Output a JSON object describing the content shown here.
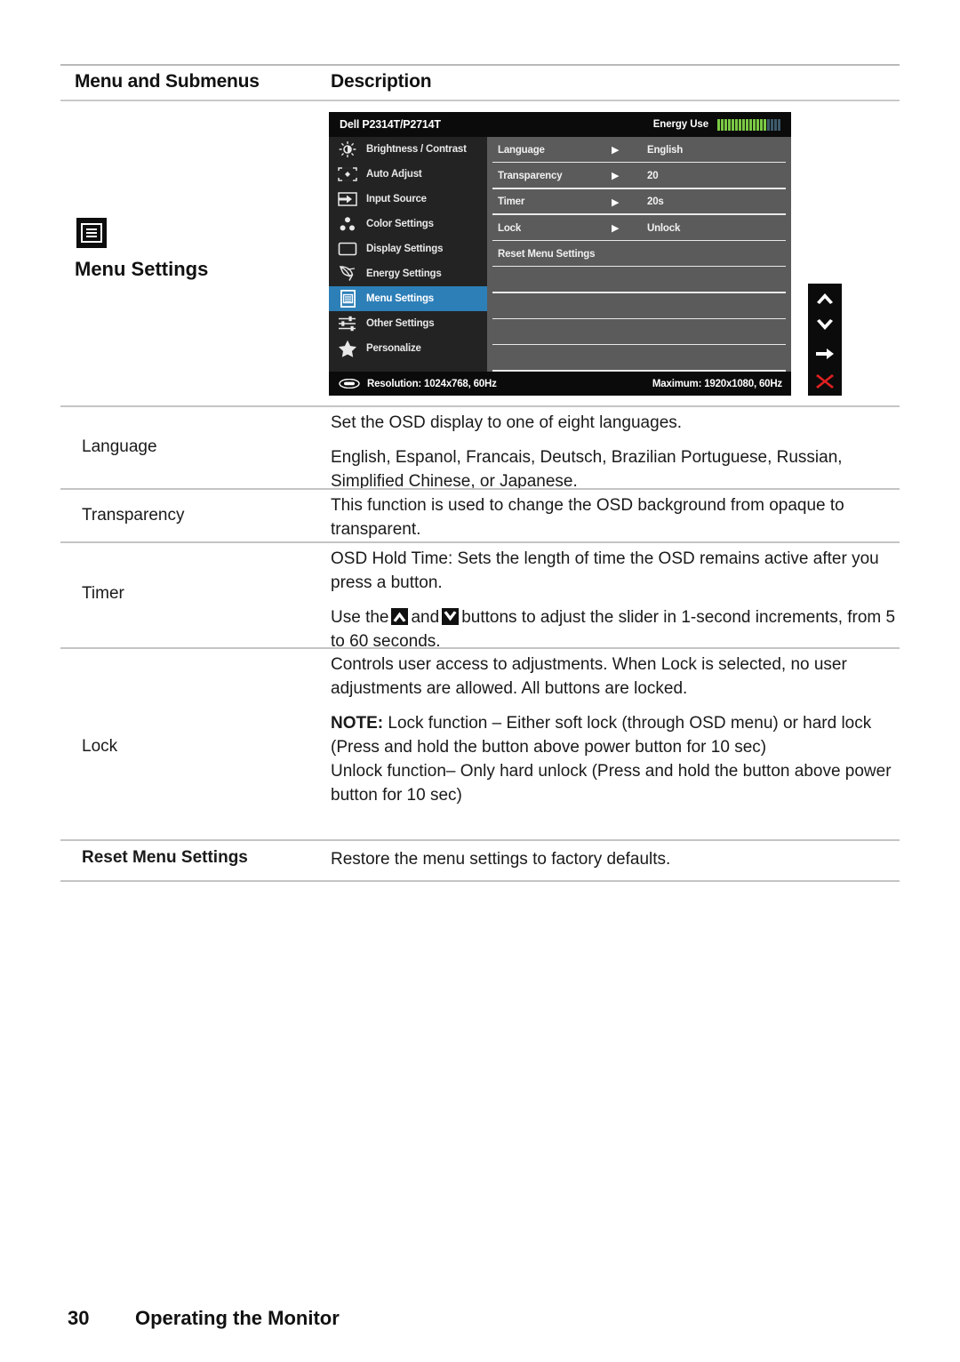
{
  "table_header": {
    "col1": "Menu and Submenus",
    "col2": "Description"
  },
  "left_cell": {
    "icon": "menu-settings-icon",
    "label": "Menu Settings"
  },
  "osd": {
    "title": "Dell P2314T/P2714T",
    "energy_label": "Energy Use",
    "energy_bars_filled": 14,
    "energy_bars_empty": 4,
    "energy_color_filled": "#7ac943",
    "energy_color_empty": "#3d5a6c",
    "highlight_color": "#2d7fb8",
    "sidebar": [
      {
        "label": "Brightness / Contrast",
        "icon": "brightness-icon",
        "active": false
      },
      {
        "label": "Auto Adjust",
        "icon": "auto-adjust-icon",
        "active": false
      },
      {
        "label": "Input Source",
        "icon": "input-source-icon",
        "active": false
      },
      {
        "label": "Color Settings",
        "icon": "color-settings-icon",
        "active": false
      },
      {
        "label": "Display Settings",
        "icon": "display-settings-icon",
        "active": false
      },
      {
        "label": "Energy Settings",
        "icon": "leaf-icon",
        "active": false
      },
      {
        "label": "Menu Settings",
        "icon": "menu-settings-icon",
        "active": true
      },
      {
        "label": "Other Settings",
        "icon": "sliders-icon",
        "active": false
      },
      {
        "label": "Personalize",
        "icon": "star-icon",
        "active": false
      }
    ],
    "rows": [
      {
        "label": "Language",
        "arrow": "▶",
        "value": "English"
      },
      {
        "label": "Transparency",
        "arrow": "▶",
        "value": "20"
      },
      {
        "label": "Timer",
        "arrow": "▶",
        "value": "20s"
      },
      {
        "label": "Lock",
        "arrow": "▶",
        "value": "Unlock"
      },
      {
        "label": "Reset Menu Settings",
        "arrow": "",
        "value": ""
      },
      {
        "label": "",
        "arrow": "",
        "value": ""
      },
      {
        "label": "",
        "arrow": "",
        "value": ""
      },
      {
        "label": "",
        "arrow": "",
        "value": ""
      },
      {
        "label": "",
        "arrow": "",
        "value": ""
      }
    ],
    "footer": {
      "resolution": "Resolution:  1024x768, 60Hz",
      "maximum": "Maximum: 1920x1080, 60Hz"
    },
    "nav_buttons": [
      {
        "icon": "chevron-up-icon",
        "color": "#ffffff"
      },
      {
        "icon": "chevron-down-icon",
        "color": "#ffffff"
      },
      {
        "icon": "arrow-right-icon",
        "color": "#ffffff"
      },
      {
        "icon": "close-x-icon",
        "color": "#e02020"
      }
    ]
  },
  "rows": {
    "language": {
      "label": "Language",
      "p1": "Set the OSD display to one of eight languages.",
      "p2": "English, Espanol, Francais, Deutsch, Brazilian Portuguese, Russian, Simplified Chinese, or Japanese."
    },
    "transparency": {
      "label": "Transparency",
      "p1": "This function is used to change the OSD background from opaque to transparent."
    },
    "timer": {
      "label": "Timer",
      "p1": "OSD Hold Time: Sets the length of time the OSD remains active after you press a button.",
      "p2_a": "Use the",
      "p2_b": "and",
      "p2_c": "buttons to adjust the slider in 1-second increments, from 5 to 60 seconds."
    },
    "lock": {
      "label": "Lock",
      "p1": "Controls user access to adjustments. When Lock is selected, no user adjustments are allowed. All buttons are locked.",
      "note_bold": "NOTE:",
      "note_text": " Lock function – Either soft lock (through OSD menu) or hard lock (Press and hold the button above power button for 10 sec)",
      "p3": "Unlock function– Only hard unlock (Press and hold the button above power button for 10 sec)"
    },
    "reset": {
      "label": "Reset Menu Settings",
      "p1": "Restore the menu settings to factory defaults."
    }
  },
  "footer": {
    "page_number": "30",
    "section_title": "Operating the Monitor"
  }
}
